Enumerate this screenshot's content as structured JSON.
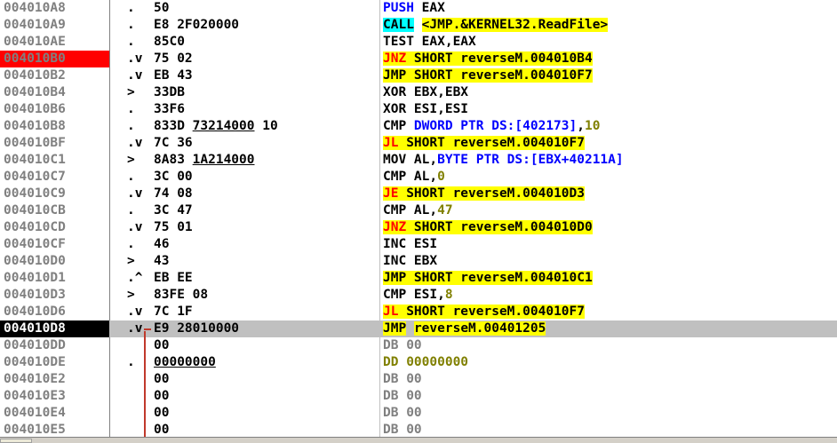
{
  "rows": [
    {
      "addr": "004010A8",
      "mark": ".",
      "bytes": "50",
      "instr": [
        {
          "t": "PUSH",
          "c": "m-blue"
        },
        {
          "t": " EAX"
        }
      ]
    },
    {
      "addr": "004010A9",
      "mark": ".",
      "bytes": "E8 2F020000",
      "instr": [
        {
          "t": "CALL",
          "c": "hl-c"
        },
        {
          "t": " "
        },
        {
          "t": "<JMP.&KERNEL32.ReadFile>",
          "c": "hl-y"
        }
      ]
    },
    {
      "addr": "004010AE",
      "mark": ".",
      "bytes": "85C0",
      "instr": [
        {
          "t": "TEST EAX,EAX"
        }
      ]
    },
    {
      "addr": "004010B0",
      "mark": ".v",
      "bytes": "75 02",
      "state": "bp",
      "instr": [
        {
          "t": "JNZ",
          "c": "hl-y m-red"
        },
        {
          "t": " SHORT reverseM.004010B4",
          "c": "hl-y"
        }
      ]
    },
    {
      "addr": "004010B2",
      "mark": ".v",
      "bytes": "EB 43",
      "instr": [
        {
          "t": "JMP SHORT reverseM.004010F7",
          "c": "hl-y"
        }
      ]
    },
    {
      "addr": "004010B4",
      "mark": ">",
      "bytes": "33DB",
      "instr": [
        {
          "t": "XOR EBX,EBX"
        }
      ]
    },
    {
      "addr": "004010B6",
      "mark": ".",
      "bytes": "33F6",
      "instr": [
        {
          "t": "XOR ESI,ESI"
        }
      ]
    },
    {
      "addr": "004010B8",
      "mark": ".",
      "bytes": "833D 73214000 10",
      "ul": "73214000",
      "instr": [
        {
          "t": "CMP "
        },
        {
          "t": "DWORD PTR DS:[402173]",
          "c": "m-blue"
        },
        {
          "t": ","
        },
        {
          "t": "10",
          "c": "num"
        }
      ]
    },
    {
      "addr": "004010BF",
      "mark": ".v",
      "bytes": "7C 36",
      "instr": [
        {
          "t": "JL",
          "c": "hl-y m-red"
        },
        {
          "t": " SHORT reverseM.004010F7",
          "c": "hl-y"
        }
      ]
    },
    {
      "addr": "004010C1",
      "mark": ">",
      "bytes": "8A83 1A214000",
      "ul": "1A214000",
      "instr": [
        {
          "t": "MOV AL,"
        },
        {
          "t": "BYTE PTR DS:[EBX+40211A]",
          "c": "m-blue"
        }
      ]
    },
    {
      "addr": "004010C7",
      "mark": ".",
      "bytes": "3C 00",
      "instr": [
        {
          "t": "CMP AL,"
        },
        {
          "t": "0",
          "c": "num"
        }
      ]
    },
    {
      "addr": "004010C9",
      "mark": ".v",
      "bytes": "74 08",
      "instr": [
        {
          "t": "JE",
          "c": "hl-y m-red"
        },
        {
          "t": " SHORT reverseM.004010D3",
          "c": "hl-y"
        }
      ]
    },
    {
      "addr": "004010CB",
      "mark": ".",
      "bytes": "3C 47",
      "instr": [
        {
          "t": "CMP AL,"
        },
        {
          "t": "47",
          "c": "num"
        }
      ]
    },
    {
      "addr": "004010CD",
      "mark": ".v",
      "bytes": "75 01",
      "instr": [
        {
          "t": "JNZ",
          "c": "hl-y m-red"
        },
        {
          "t": " SHORT reverseM.004010D0",
          "c": "hl-y"
        }
      ]
    },
    {
      "addr": "004010CF",
      "mark": ".",
      "bytes": "46",
      "instr": [
        {
          "t": "INC ESI"
        }
      ]
    },
    {
      "addr": "004010D0",
      "mark": ">",
      "bytes": "43",
      "instr": [
        {
          "t": "INC EBX"
        }
      ]
    },
    {
      "addr": "004010D1",
      "mark": ".^",
      "bytes": "EB EE",
      "instr": [
        {
          "t": "JMP SHORT reverseM.004010C1",
          "c": "hl-y"
        }
      ]
    },
    {
      "addr": "004010D3",
      "mark": ">",
      "bytes": "83FE 08",
      "instr": [
        {
          "t": "CMP ESI,"
        },
        {
          "t": "8",
          "c": "num"
        }
      ]
    },
    {
      "addr": "004010D6",
      "mark": ".v",
      "bytes": "7C 1F",
      "instr": [
        {
          "t": "JL",
          "c": "hl-y m-red"
        },
        {
          "t": " SHORT reverseM.004010F7",
          "c": "hl-y"
        }
      ]
    },
    {
      "addr": "004010D8",
      "mark": ".v",
      "bytes": "E9 28010000",
      "state": "current",
      "instr": [
        {
          "t": "JMP",
          "c": "hl-y"
        },
        {
          "t": " "
        },
        {
          "t": "reverseM.00401205",
          "c": "hl-y"
        }
      ]
    },
    {
      "addr": "004010DD",
      "mark": "",
      "bytes": "00",
      "instr": [
        {
          "t": "DB 00",
          "c": "dim"
        }
      ]
    },
    {
      "addr": "004010DE",
      "mark": ".",
      "bytes": "00000000",
      "ul": "00000000",
      "instr": [
        {
          "t": "DD ",
          "c": "num"
        },
        {
          "t": "00000000",
          "c": "num"
        }
      ]
    },
    {
      "addr": "004010E2",
      "mark": "",
      "bytes": "00",
      "instr": [
        {
          "t": "DB 00",
          "c": "dim"
        }
      ]
    },
    {
      "addr": "004010E3",
      "mark": "",
      "bytes": "00",
      "instr": [
        {
          "t": "DB 00",
          "c": "dim"
        }
      ]
    },
    {
      "addr": "004010E4",
      "mark": "",
      "bytes": "00",
      "instr": [
        {
          "t": "DB 00",
          "c": "dim"
        }
      ]
    },
    {
      "addr": "004010E5",
      "mark": "",
      "bytes": "00",
      "instr": [
        {
          "t": "DB 00",
          "c": "dim"
        }
      ]
    }
  ],
  "colors": {
    "breakpoint": "#ff0000",
    "current_row": "#c0c0c0",
    "jump_highlight": "#ffff00",
    "call_highlight": "#00ffff",
    "mnemonic_red": "#ff0000",
    "operand_blue": "#0000ff",
    "constant": "#808000"
  }
}
